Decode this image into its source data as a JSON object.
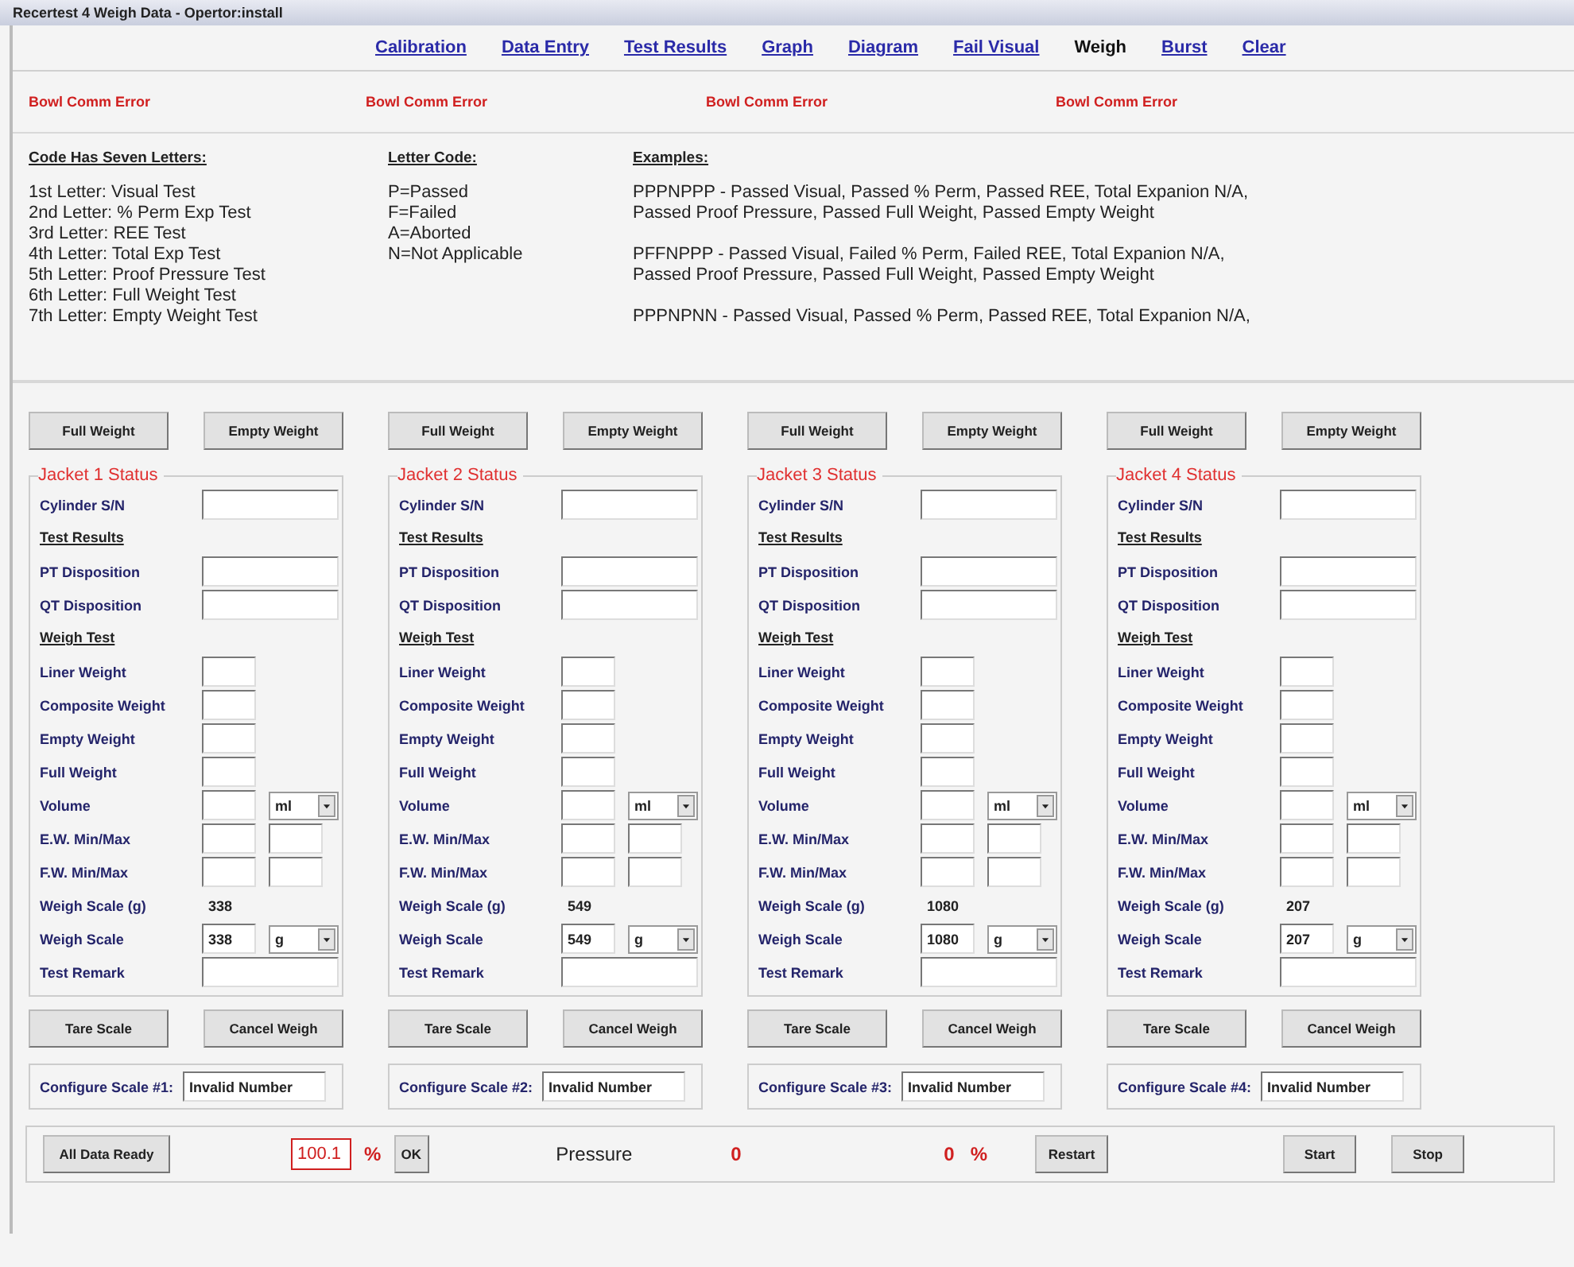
{
  "window": {
    "title": "Recertest 4 Weigh Data - Opertor:install"
  },
  "nav": [
    {
      "label": "Calibration",
      "selected": false
    },
    {
      "label": "Data Entry",
      "selected": false
    },
    {
      "label": "Test Results",
      "selected": false
    },
    {
      "label": "Graph",
      "selected": false
    },
    {
      "label": "Diagram",
      "selected": false
    },
    {
      "label": "Fail Visual",
      "selected": false
    },
    {
      "label": "Weigh",
      "selected": true
    },
    {
      "label": "Burst",
      "selected": false
    },
    {
      "label": "Clear",
      "selected": false
    }
  ],
  "errors": [
    "Bowl Comm Error",
    "Bowl Comm Error",
    "Bowl Comm Error",
    "Bowl Comm Error"
  ],
  "legend": {
    "code": {
      "heading": "Code Has Seven Letters:",
      "lines": [
        "1st Letter: Visual Test",
        "2nd Letter: % Perm Exp Test",
        "3rd Letter: REE Test",
        "4th Letter: Total Exp Test",
        "5th Letter: Proof Pressure Test",
        "6th Letter: Full Weight Test",
        "7th Letter: Empty Weight Test"
      ]
    },
    "letters": {
      "heading": "Letter Code:",
      "lines": [
        "P=Passed",
        "F=Failed",
        "A=Aborted",
        "N=Not Applicable"
      ]
    },
    "examples": {
      "heading": "Examples:",
      "groups": [
        [
          "PPPNPPP - Passed Visual, Passed % Perm, Passed REE, Total Expanion N/A,",
          "Passed Proof Pressure, Passed Full Weight, Passed Empty Weight"
        ],
        [
          "PFFNPPP - Passed Visual, Failed % Perm, Failed REE, Total Expanion N/A,",
          "Passed Proof Pressure, Passed Full Weight, Passed Empty Weight"
        ],
        [
          "PPPNPNN - Passed Visual, Passed % Perm, Passed REE, Total Expanion N/A,"
        ]
      ]
    }
  },
  "jackets": [
    {
      "buttons": [
        "Full Weight",
        "Empty Weight"
      ],
      "title": "Jacket 1 Status",
      "rows": [
        {
          "kind": "wide",
          "label": "Cylinder S/N"
        },
        {
          "kind": "heading",
          "label": "Test Results"
        },
        {
          "kind": "wide",
          "label": "PT Disposition"
        },
        {
          "kind": "wide",
          "label": "QT Disposition"
        },
        {
          "kind": "heading",
          "label": "Weigh Test"
        },
        {
          "kind": "short",
          "label": "Liner Weight"
        },
        {
          "kind": "short",
          "label": "Composite Weight"
        },
        {
          "kind": "short",
          "label": "Empty Weight"
        },
        {
          "kind": "short",
          "label": "Full Weight"
        },
        {
          "kind": "unit",
          "label": "Volume",
          "unit": "ml"
        },
        {
          "kind": "pair",
          "label": "E.W. Min/Max"
        },
        {
          "kind": "pair",
          "label": "F.W. Min/Max"
        },
        {
          "kind": "reading",
          "label": "Weigh Scale (g)",
          "value": "338"
        },
        {
          "kind": "unit",
          "label": "Weigh Scale",
          "value": "338",
          "unit": "g"
        },
        {
          "kind": "wide",
          "label": "Test Remark"
        }
      ],
      "actions": [
        "Tare Scale",
        "Cancel Weigh"
      ],
      "configure": {
        "label": "Configure Scale #1:",
        "value": "Invalid Number"
      }
    },
    {
      "buttons": [
        "Full Weight",
        "Empty Weight"
      ],
      "title": "Jacket 2 Status",
      "rows": [
        {
          "kind": "wide",
          "label": "Cylinder S/N"
        },
        {
          "kind": "heading",
          "label": "Test Results"
        },
        {
          "kind": "wide",
          "label": "PT Disposition"
        },
        {
          "kind": "wide",
          "label": "QT Disposition"
        },
        {
          "kind": "heading",
          "label": "Weigh Test"
        },
        {
          "kind": "short",
          "label": "Liner Weight"
        },
        {
          "kind": "short",
          "label": "Composite Weight"
        },
        {
          "kind": "short",
          "label": "Empty Weight"
        },
        {
          "kind": "short",
          "label": "Full Weight"
        },
        {
          "kind": "unit",
          "label": "Volume",
          "unit": "ml"
        },
        {
          "kind": "pair",
          "label": "E.W. Min/Max"
        },
        {
          "kind": "pair",
          "label": "F.W. Min/Max"
        },
        {
          "kind": "reading",
          "label": "Weigh Scale (g)",
          "value": "549"
        },
        {
          "kind": "unit",
          "label": "Weigh Scale",
          "value": "549",
          "unit": "g"
        },
        {
          "kind": "wide",
          "label": "Test Remark"
        }
      ],
      "actions": [
        "Tare Scale",
        "Cancel Weigh"
      ],
      "configure": {
        "label": "Configure Scale #2:",
        "value": "Invalid Number"
      }
    },
    {
      "buttons": [
        "Full Weight",
        "Empty Weight"
      ],
      "title": "Jacket 3 Status",
      "rows": [
        {
          "kind": "wide",
          "label": "Cylinder S/N"
        },
        {
          "kind": "heading",
          "label": "Test Results"
        },
        {
          "kind": "wide",
          "label": "PT Disposition"
        },
        {
          "kind": "wide",
          "label": "QT Disposition"
        },
        {
          "kind": "heading",
          "label": "Weigh Test"
        },
        {
          "kind": "short",
          "label": "Liner Weight"
        },
        {
          "kind": "short",
          "label": "Composite Weight"
        },
        {
          "kind": "short",
          "label": "Empty Weight"
        },
        {
          "kind": "short",
          "label": "Full Weight"
        },
        {
          "kind": "unit",
          "label": "Volume",
          "unit": "ml"
        },
        {
          "kind": "pair",
          "label": "E.W. Min/Max"
        },
        {
          "kind": "pair",
          "label": "F.W. Min/Max"
        },
        {
          "kind": "reading",
          "label": "Weigh Scale (g)",
          "value": "1080"
        },
        {
          "kind": "unit",
          "label": "Weigh Scale",
          "value": "1080",
          "unit": "g"
        },
        {
          "kind": "wide",
          "label": "Test Remark"
        }
      ],
      "actions": [
        "Tare Scale",
        "Cancel Weigh"
      ],
      "configure": {
        "label": "Configure Scale #3:",
        "value": "Invalid Number"
      }
    },
    {
      "buttons": [
        "Full Weight",
        "Empty Weight"
      ],
      "title": "Jacket 4 Status",
      "rows": [
        {
          "kind": "wide",
          "label": "Cylinder S/N"
        },
        {
          "kind": "heading",
          "label": "Test Results"
        },
        {
          "kind": "wide",
          "label": "PT Disposition"
        },
        {
          "kind": "wide",
          "label": "QT Disposition"
        },
        {
          "kind": "heading",
          "label": "Weigh Test"
        },
        {
          "kind": "short",
          "label": "Liner Weight"
        },
        {
          "kind": "short",
          "label": "Composite Weight"
        },
        {
          "kind": "short",
          "label": "Empty Weight"
        },
        {
          "kind": "short",
          "label": "Full Weight"
        },
        {
          "kind": "unit",
          "label": "Volume",
          "unit": "ml"
        },
        {
          "kind": "pair",
          "label": "E.W. Min/Max"
        },
        {
          "kind": "pair",
          "label": "F.W. Min/Max"
        },
        {
          "kind": "reading",
          "label": "Weigh Scale (g)",
          "value": "207"
        },
        {
          "kind": "unit",
          "label": "Weigh Scale",
          "value": "207",
          "unit": "g"
        },
        {
          "kind": "wide",
          "label": "Test Remark"
        }
      ],
      "actions": [
        "Tare Scale",
        "Cancel Weigh"
      ],
      "configure": {
        "label": "Configure Scale #4:",
        "value": "Invalid Number"
      }
    }
  ],
  "bottom": {
    "ready_button": "All Data Ready",
    "percent_value": "100.1",
    "percent_unit": "%",
    "ok_button": "OK",
    "pressure_label": "Pressure",
    "pressure_value": "0",
    "progress_value": "0",
    "progress_unit": "%",
    "restart_button": "Restart",
    "start_button": "Start",
    "stop_button": "Stop"
  }
}
